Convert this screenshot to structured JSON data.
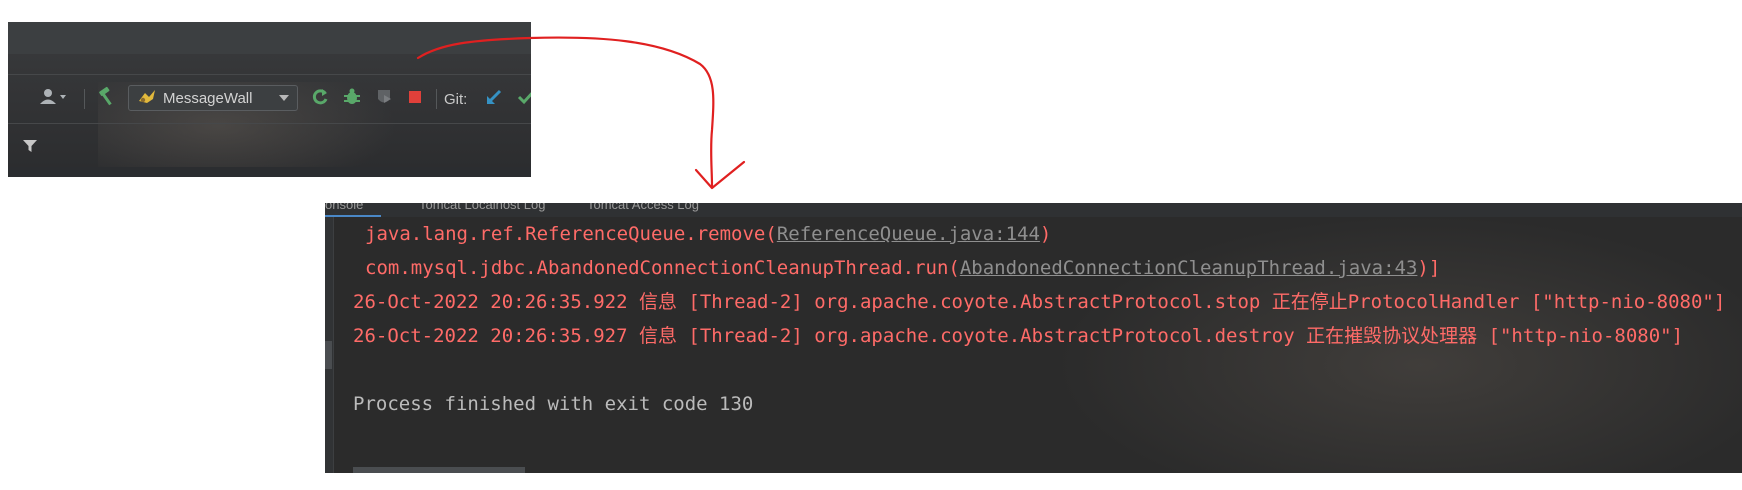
{
  "toolbar": {
    "user_icon": "user-icon",
    "build_icon": "hammer-icon",
    "run_config_label": "MessageWall",
    "rerun_icon": "rerun-icon",
    "debug_icon": "debug-icon",
    "coverage_icon": "coverage-icon",
    "stop_icon": "stop-icon",
    "git_label": "Git:",
    "git_update_icon": "update-project-icon",
    "git_commit_icon": "commit-check-icon",
    "filter_icon": "filter-icon"
  },
  "console": {
    "tabs": [
      {
        "label": "onsole"
      },
      {
        "label": "Tomcat Localhost Log"
      },
      {
        "label": "Tomcat Access Log"
      }
    ],
    "lines": {
      "line1_prefix": "java.lang.ref.ReferenceQueue.remove(",
      "line1_link": "ReferenceQueue.java:144",
      "line1_suffix": ")",
      "line2_prefix": "com.mysql.jdbc.AbandonedConnectionCleanupThread.run(",
      "line2_link": "AbandonedConnectionCleanupThread.java:43",
      "line2_suffix": ")]",
      "line3": "26-Oct-2022 20:26:35.922 信息 [Thread-2] org.apache.coyote.AbstractProtocol.stop 正在停止ProtocolHandler [\"http-nio-8080\"]",
      "line4": "26-Oct-2022 20:26:35.927 信息 [Thread-2] org.apache.coyote.AbstractProtocol.destroy 正在摧毁协议处理器 [\"http-nio-8080\"]",
      "line5": "",
      "line6": "Process finished with exit code 130"
    }
  },
  "colors": {
    "error_text": "#ff6b68",
    "normal_text": "#bbbbbb",
    "annotation": "#e02020",
    "stop_red": "#e0403a"
  }
}
